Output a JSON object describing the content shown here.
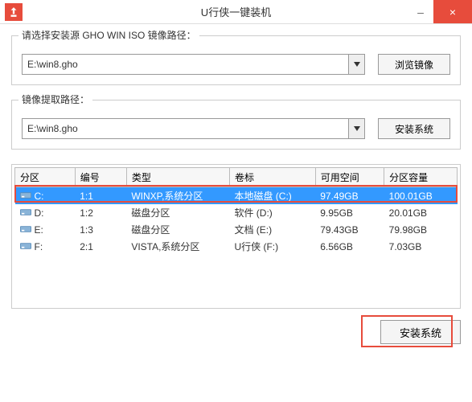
{
  "titlebar": {
    "title": "U行侠一键装机",
    "minimize": "–",
    "close": "×"
  },
  "group1": {
    "label": "请选择安装源 GHO WIN ISO 镜像路径：",
    "value": "E:\\win8.gho",
    "button": "浏览镜像"
  },
  "group2": {
    "label": "镜像提取路径：",
    "value": "E:\\win8.gho",
    "button": "安装系统"
  },
  "table": {
    "headers": {
      "partition": "分区",
      "number": "编号",
      "type": "类型",
      "label": "卷标",
      "free": "可用空间",
      "capacity": "分区容量"
    },
    "rows": [
      {
        "partition": "C:",
        "number": "1:1",
        "type": "WINXP,系统分区",
        "label": "本地磁盘 (C:)",
        "free": "97.49GB",
        "capacity": "100.01GB",
        "selected": true
      },
      {
        "partition": "D:",
        "number": "1:2",
        "type": "磁盘分区",
        "label": "软件 (D:)",
        "free": "9.95GB",
        "capacity": "20.01GB",
        "selected": false
      },
      {
        "partition": "E:",
        "number": "1:3",
        "type": "磁盘分区",
        "label": "文档 (E:)",
        "free": "79.43GB",
        "capacity": "79.98GB",
        "selected": false
      },
      {
        "partition": "F:",
        "number": "2:1",
        "type": "VISTA,系统分区",
        "label": "U行侠 (F:)",
        "free": "6.56GB",
        "capacity": "7.03GB",
        "selected": false
      }
    ]
  },
  "install_button": "安装系统"
}
